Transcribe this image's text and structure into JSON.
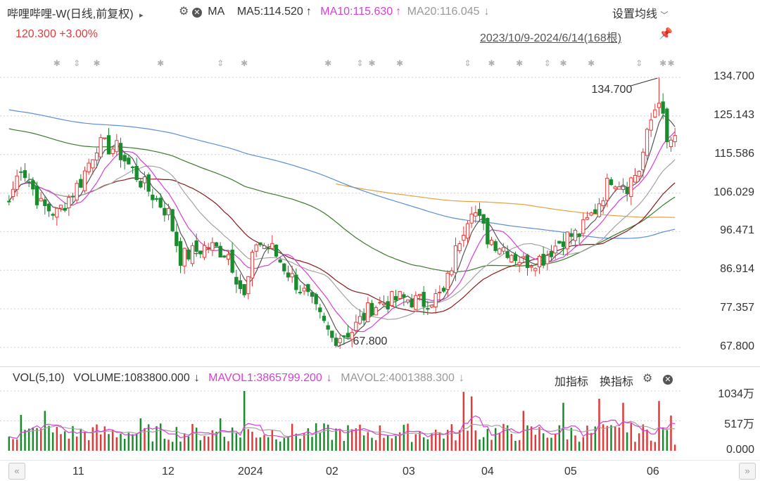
{
  "header": {
    "title": "哔哩哔哩-W",
    "title_suffix": "(日线,前复权)",
    "ma_label": "MA",
    "ma5": "MA5:114.520",
    "ma10": "MA10:115.630",
    "ma20": "MA20:116.045",
    "settings": "设置均线",
    "price_change": "120.300 +3.00%",
    "range": "2023/10/9-2024/6/14(168根)"
  },
  "vol_header": {
    "vol_label": "VOL(5,10)",
    "volume": "VOLUME:1083800.000",
    "mavol1": "MAVOL1:3865799.200",
    "mavol2": "MAVOL2:4001388.300",
    "add_indicator": "加指标",
    "switch_indicator": "换指标"
  },
  "colors": {
    "up": "#e03a3a",
    "down": "#1a8c2e",
    "ma5": "#555555",
    "ma10": "#d63fd6",
    "ma20": "#a3a3a3",
    "ma30": "#8b1a1a",
    "ma60": "#3a7a2a",
    "ma120": "#5b8fd6",
    "ma250": "#e6a23c"
  },
  "chart_data": {
    "type": "candlestick",
    "title": "哔哩哔哩-W (日线,前复权)",
    "ylim": [
      67.8,
      134.7
    ],
    "y_ticks": [
      "134.700",
      "125.143",
      "115.586",
      "106.029",
      "96.471",
      "86.914",
      "77.357",
      "67.800"
    ],
    "x_ticks": [
      "11",
      "12",
      "2024",
      "02",
      "03",
      "04",
      "05",
      "06"
    ],
    "annotations": [
      {
        "text": "134.700",
        "type": "high"
      },
      {
        "text": "67.800",
        "type": "low"
      }
    ],
    "price_anchors": [
      {
        "bar": 0,
        "close": 104
      },
      {
        "bar": 3,
        "close": 113
      },
      {
        "bar": 8,
        "close": 103
      },
      {
        "bar": 12,
        "close": 101
      },
      {
        "bar": 18,
        "close": 109
      },
      {
        "bar": 22,
        "close": 118
      },
      {
        "bar": 27,
        "close": 117
      },
      {
        "bar": 33,
        "close": 109
      },
      {
        "bar": 40,
        "close": 101
      },
      {
        "bar": 43,
        "close": 90
      },
      {
        "bar": 50,
        "close": 93
      },
      {
        "bar": 55,
        "close": 91
      },
      {
        "bar": 59,
        "close": 80
      },
      {
        "bar": 62,
        "close": 94
      },
      {
        "bar": 66,
        "close": 92
      },
      {
        "bar": 71,
        "close": 85
      },
      {
        "bar": 75,
        "close": 80
      },
      {
        "bar": 81,
        "close": 70
      },
      {
        "bar": 86,
        "close": 72
      },
      {
        "bar": 91,
        "close": 78
      },
      {
        "bar": 98,
        "close": 80
      },
      {
        "bar": 104,
        "close": 79
      },
      {
        "bar": 109,
        "close": 81
      },
      {
        "bar": 113,
        "close": 95
      },
      {
        "bar": 116,
        "close": 103
      },
      {
        "bar": 120,
        "close": 95
      },
      {
        "bar": 125,
        "close": 92
      },
      {
        "bar": 129,
        "close": 89
      },
      {
        "bar": 134,
        "close": 90
      },
      {
        "bar": 139,
        "close": 95
      },
      {
        "bar": 143,
        "close": 96
      },
      {
        "bar": 147,
        "close": 102
      },
      {
        "bar": 151,
        "close": 110
      },
      {
        "bar": 155,
        "close": 108
      },
      {
        "bar": 158,
        "close": 112
      },
      {
        "bar": 161,
        "close": 124
      },
      {
        "bar": 163,
        "close": 130
      },
      {
        "bar": 165,
        "close": 118
      },
      {
        "bar": 167,
        "close": 120.3
      }
    ],
    "volume": {
      "unit_ticks": [
        "1034万",
        "517万",
        "0.000"
      ],
      "max": 1034,
      "spikes": [
        {
          "bar": 3,
          "value": 620
        },
        {
          "bar": 9,
          "value": 690
        },
        {
          "bar": 33,
          "value": 560
        },
        {
          "bar": 53,
          "value": 560
        },
        {
          "bar": 59,
          "value": 1034
        },
        {
          "bar": 114,
          "value": 1020
        },
        {
          "bar": 116,
          "value": 940
        },
        {
          "bar": 129,
          "value": 690
        },
        {
          "bar": 139,
          "value": 830
        },
        {
          "bar": 148,
          "value": 900
        },
        {
          "bar": 154,
          "value": 830
        },
        {
          "bar": 163,
          "value": 860
        },
        {
          "bar": 166,
          "value": 610
        }
      ]
    }
  }
}
